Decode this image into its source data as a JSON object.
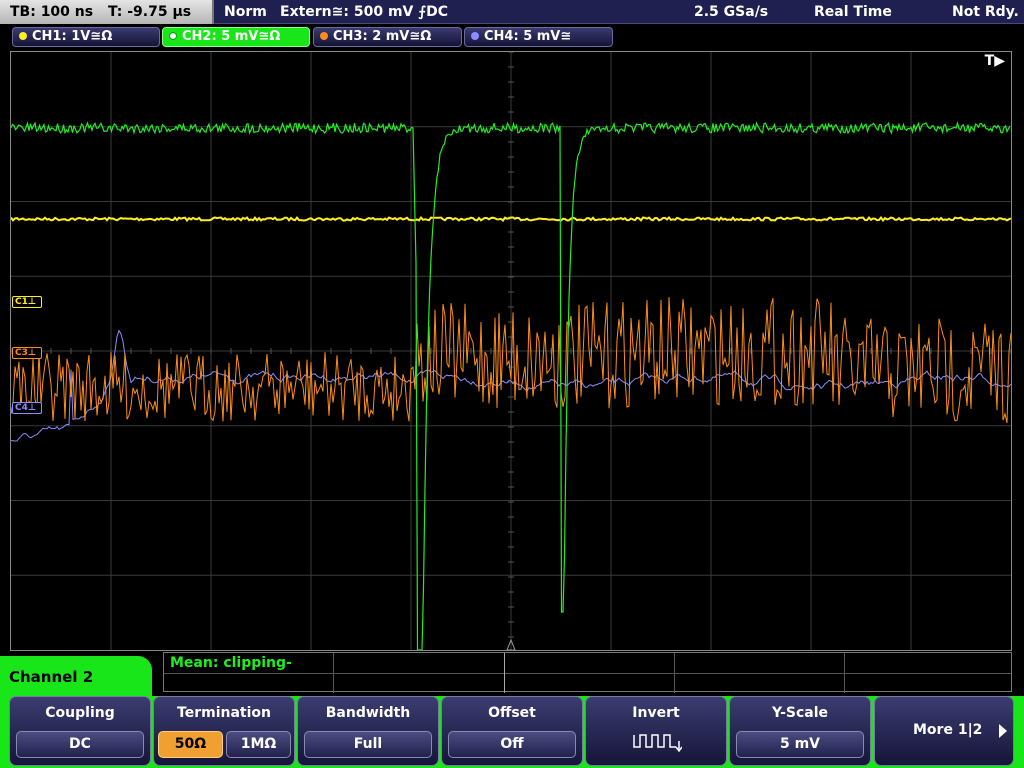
{
  "status_bar": {
    "timebase": "TB: 100 ns",
    "trigger_time": "T: -9.75 µs",
    "trigger_mode": "Norm",
    "trigger_source": "Extern≅: 500 mV ⨍DC",
    "sample_rate": "2.5 GSa/s",
    "acq_mode": "Real Time",
    "state": "Not Rdy."
  },
  "channels": [
    {
      "label": "CH1: 1V≅Ω",
      "color": "#ffee22",
      "active": false
    },
    {
      "label": "CH2: 5 mV≅Ω",
      "color": "#22ee22",
      "active": true
    },
    {
      "label": "CH3: 2 mV≅Ω",
      "color": "#ff8c1a",
      "active": false
    },
    {
      "label": "CH4: 5 mV≅",
      "color": "#8c8cff",
      "active": false
    }
  ],
  "screen": {
    "trigger_marker": "T▶",
    "markers": [
      {
        "label": "C1⊥",
        "color": "#ffee22"
      },
      {
        "label": "C3⊥",
        "color": "#ff8c1a"
      },
      {
        "label": "C4⊥",
        "color": "#8c8cff"
      }
    ]
  },
  "measurement": {
    "text": "Mean: clipping-"
  },
  "menu": {
    "title": "Channel 2",
    "coupling": {
      "title": "Coupling",
      "value": "DC"
    },
    "termination": {
      "title": "Termination",
      "opt1": "50Ω",
      "opt2": "1MΩ",
      "selected": "50Ω"
    },
    "bandwidth": {
      "title": "Bandwidth",
      "value": "Full"
    },
    "offset": {
      "title": "Offset",
      "value": "Off"
    },
    "invert": {
      "title": "Invert"
    },
    "yscale": {
      "title": "Y-Scale",
      "value": "5 mV"
    },
    "more": "More 1|2"
  },
  "icons": {
    "invert": "invert-pulse-icon",
    "more": "right-arrow-icon",
    "trigger": "trigger-pos-icon"
  }
}
